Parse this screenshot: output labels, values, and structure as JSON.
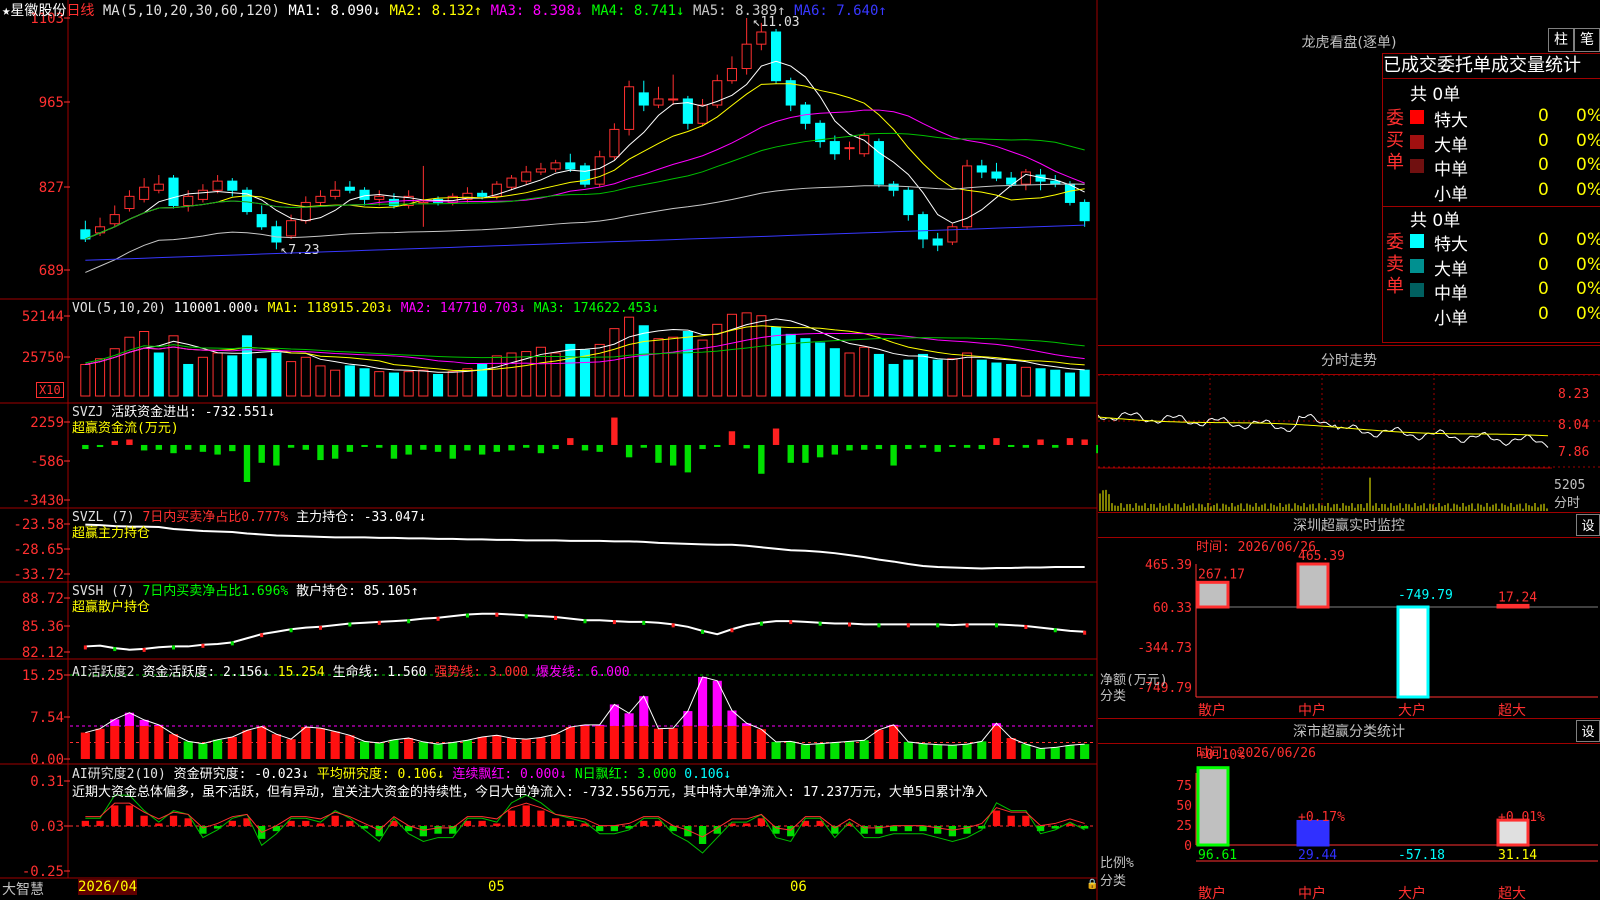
{
  "app": {
    "brand": "大智慧",
    "stock_name": "★星徽股份",
    "period": "日线"
  },
  "axis_dates": {
    "start": "2026/04",
    "may": "05",
    "jun": "06"
  },
  "main_chart": {
    "ma_header": "MA(5,10,20,30,60,120)",
    "ma_values": [
      {
        "label": "MA1: 8.090↓",
        "color": "#ffffff"
      },
      {
        "label": "MA2: 8.132↑",
        "color": "#ffff00"
      },
      {
        "label": "MA3: 8.398↓",
        "color": "#ff00ff"
      },
      {
        "label": "MA4: 8.741↓",
        "color": "#00ff00"
      },
      {
        "label": "MA5: 8.389↑",
        "color": "#c8c8c8"
      },
      {
        "label": "MA6: 7.640↑",
        "color": "#3838ff"
      }
    ],
    "y_ticks": [
      "1103",
      "965",
      "827",
      "689"
    ],
    "high_label": "11.03",
    "low_label": "7.23"
  },
  "vol_panel": {
    "header": "VOL(5,10,20)",
    "value": "110001.000↓",
    "ma1": "MA1: 118915.203↓",
    "ma2": "MA2: 147710.703↓",
    "ma3": "MA3: 174622.453↓",
    "y_ticks": [
      "52144",
      "25750"
    ],
    "unit": "X10"
  },
  "svzj_panel": {
    "header": "SVZJ",
    "line1": "活跃资金进出: -732.551↓",
    "line2": "超赢资金流(万元)",
    "y_ticks": [
      "2259",
      "-586",
      "-3430"
    ]
  },
  "svzl_panel": {
    "header": "SVZL (7)",
    "ratio": "7日内买卖净占比0.777%",
    "value": "主力持仓: -33.047↓",
    "line2": "超赢主力持仓",
    "y_ticks": [
      "-23.58",
      "-28.65",
      "-33.72"
    ]
  },
  "svsh_panel": {
    "header": "SVSH (7)",
    "ratio": "7日内买卖净占比1.696%",
    "value": "散户持仓: 85.105↑",
    "line2": "超赢散户持仓",
    "y_ticks": [
      "88.72",
      "85.36",
      "82.12"
    ]
  },
  "ai2_panel": {
    "header": "AI活跃度2",
    "v1": "资金活跃度: 2.156↓",
    "v2": "15.254",
    "v3": "生命线: 1.560",
    "v4": "强势线: 3.000",
    "v5": "爆发线: 6.000",
    "y_ticks": [
      "15.25",
      "7.54",
      "0.00"
    ]
  },
  "ai_research_panel": {
    "header": "AI研究度2(10)",
    "v1": "资金研究度: -0.023↓",
    "v2": "平均研究度: 0.106↓",
    "v3": "连续飘红: 0.000↓",
    "v4": "N日飘红: 3.000",
    "v5": "0.106↓",
    "commentary": "近期大资金总体偏多，虽不活跃，但有异动，宜关注大资金的持续性，今日大单净流入: -732.556万元，其中特大单净流入: 17.237万元，大单5日累计净入",
    "y_ticks": [
      "0.31",
      "0.03",
      "-0.25"
    ]
  },
  "right_panel": {
    "lhb": {
      "title": "龙虎看盘(逐单)",
      "btn1": "柱",
      "btn2": "笔",
      "tabs": "已成交委托单成交量统计",
      "buy_label": "委买单",
      "sell_label": "委卖单",
      "buy_total": "共 0单",
      "sell_total": "共 0单",
      "buy_rows": [
        {
          "name": "特大",
          "count": "0",
          "pct": "0%",
          "color": "#ff0000"
        },
        {
          "name": "大单",
          "count": "0",
          "pct": "0%",
          "color": "#a01010"
        },
        {
          "name": "中单",
          "count": "0",
          "pct": "0%",
          "color": "#701010"
        },
        {
          "name": "小单",
          "count": "0",
          "pct": "0%",
          "color": "#000000"
        }
      ],
      "sell_rows": [
        {
          "name": "特大",
          "count": "0",
          "pct": "0%",
          "color": "#00ffff"
        },
        {
          "name": "大单",
          "count": "0",
          "pct": "0%",
          "color": "#009090"
        },
        {
          "name": "中单",
          "count": "0",
          "pct": "0%",
          "color": "#006060"
        },
        {
          "name": "小单",
          "count": "0",
          "pct": "0%",
          "color": "#000000"
        }
      ]
    },
    "intraday": {
      "title": "分时走势",
      "y_ticks": [
        "8.23",
        "8.04",
        "7.86"
      ],
      "vol_tick": "5205",
      "vol_unit": "分时"
    },
    "sz_monitor": {
      "title": "深圳超赢实时监控",
      "btn": "设",
      "time": "时间: 2026/06/26",
      "y_ticks": [
        "465.39",
        "60.33",
        "-344.73",
        "-749.79"
      ],
      "ylabel": "净额(万元)",
      "xlabel": "分类",
      "categories": [
        "散户",
        "中户",
        "大户",
        "超大"
      ],
      "values": [
        267.17,
        465.39,
        -749.79,
        17.24
      ],
      "value_labels": [
        "267.17",
        "465.39",
        "-749.79",
        "17.24"
      ]
    },
    "sz_classify": {
      "title": "深市超赢分类统计",
      "btn": "设",
      "time": "时间: 2026/06/26",
      "y_ticks": [
        "75",
        "50",
        "25",
        "0"
      ],
      "ylabel": "比例%",
      "xlabel": "分类",
      "categories": [
        "散户",
        "中户",
        "大户",
        "超大"
      ],
      "top_labels": [
        "+0.10%",
        "+0.17%",
        "",
        "+0.01%"
      ],
      "bottom_labels": [
        "96.61",
        "29.44",
        "-57.18",
        "31.14"
      ],
      "values": [
        96.61,
        29.44,
        -57.18,
        31.14
      ]
    }
  },
  "chart_data": [
    {
      "type": "candlestick",
      "title": "★星徽股份 日线",
      "ylim": [
        6.89,
        11.03
      ],
      "ohlc": [
        [
          7.55,
          7.4,
          7.7,
          7.35
        ],
        [
          7.5,
          7.6,
          7.75,
          7.45
        ],
        [
          7.65,
          7.8,
          7.95,
          7.6
        ],
        [
          7.9,
          8.1,
          8.2,
          7.85
        ],
        [
          8.05,
          8.25,
          8.4,
          8.0
        ],
        [
          8.2,
          8.3,
          8.45,
          8.15
        ],
        [
          8.4,
          7.95,
          8.45,
          7.9
        ],
        [
          7.95,
          8.1,
          8.2,
          7.85
        ],
        [
          8.05,
          8.2,
          8.3,
          8.0
        ],
        [
          8.2,
          8.35,
          8.45,
          8.15
        ],
        [
          8.35,
          8.2,
          8.4,
          8.1
        ],
        [
          8.2,
          7.85,
          8.25,
          7.8
        ],
        [
          7.8,
          7.6,
          7.95,
          7.55
        ],
        [
          7.6,
          7.35,
          7.7,
          7.23
        ],
        [
          7.45,
          7.7,
          7.8,
          7.4
        ],
        [
          7.7,
          8.0,
          8.1,
          7.65
        ],
        [
          8.0,
          8.1,
          8.2,
          7.95
        ],
        [
          8.1,
          8.2,
          8.35,
          8.05
        ],
        [
          8.25,
          8.2,
          8.35,
          8.15
        ],
        [
          8.2,
          8.05,
          8.25,
          7.95
        ],
        [
          8.05,
          8.1,
          8.2,
          7.95
        ],
        [
          8.05,
          7.95,
          8.15,
          7.9
        ],
        [
          7.95,
          8.1,
          8.2,
          7.9
        ],
        [
          7.98,
          8.0,
          8.6,
          7.6
        ],
        [
          8.05,
          8.0,
          8.1,
          7.95
        ],
        [
          8.0,
          8.1,
          8.15,
          7.95
        ],
        [
          8.05,
          8.15,
          8.25,
          8.0
        ],
        [
          8.15,
          8.1,
          8.2,
          8.05
        ],
        [
          8.1,
          8.3,
          8.35,
          8.05
        ],
        [
          8.25,
          8.4,
          8.45,
          8.2
        ],
        [
          8.35,
          8.5,
          8.6,
          8.3
        ],
        [
          8.5,
          8.55,
          8.65,
          8.45
        ],
        [
          8.55,
          8.65,
          8.7,
          8.5
        ],
        [
          8.65,
          8.55,
          8.8,
          8.5
        ],
        [
          8.6,
          8.3,
          8.65,
          8.25
        ],
        [
          8.3,
          8.75,
          8.85,
          8.25
        ],
        [
          8.75,
          9.2,
          9.3,
          8.7
        ],
        [
          9.2,
          9.9,
          10.0,
          9.1
        ],
        [
          9.8,
          9.6,
          10.0,
          9.5
        ],
        [
          9.6,
          9.7,
          9.9,
          9.55
        ],
        [
          9.7,
          9.7,
          10.1,
          9.6
        ],
        [
          9.7,
          9.3,
          9.75,
          9.2
        ],
        [
          9.3,
          9.6,
          9.7,
          9.25
        ],
        [
          9.6,
          10.0,
          10.1,
          9.55
        ],
        [
          10.0,
          10.2,
          10.4,
          9.95
        ],
        [
          10.2,
          10.6,
          11.03,
          10.1
        ],
        [
          10.6,
          10.8,
          10.95,
          10.5
        ],
        [
          10.8,
          10.0,
          10.85,
          9.95
        ],
        [
          10.0,
          9.6,
          10.05,
          9.5
        ],
        [
          9.6,
          9.3,
          9.65,
          9.2
        ],
        [
          9.3,
          9.0,
          9.35,
          8.9
        ],
        [
          9.0,
          8.8,
          9.1,
          8.7
        ],
        [
          8.9,
          8.9,
          9.0,
          8.7
        ],
        [
          8.8,
          9.1,
          9.15,
          8.75
        ],
        [
          9.0,
          8.3,
          9.05,
          8.25
        ],
        [
          8.3,
          8.2,
          8.35,
          8.1
        ],
        [
          8.2,
          7.8,
          8.25,
          7.7
        ],
        [
          7.8,
          7.4,
          7.85,
          7.25
        ],
        [
          7.4,
          7.3,
          7.5,
          7.2
        ],
        [
          7.35,
          7.6,
          7.65,
          7.3
        ],
        [
          7.6,
          8.6,
          8.7,
          7.55
        ],
        [
          8.6,
          8.5,
          8.7,
          8.4
        ],
        [
          8.5,
          8.4,
          8.65,
          8.35
        ],
        [
          8.4,
          8.3,
          8.5,
          8.25
        ],
        [
          8.3,
          8.5,
          8.55,
          8.2
        ],
        [
          8.45,
          8.35,
          8.55,
          8.2
        ],
        [
          8.35,
          8.3,
          8.45,
          8.25
        ],
        [
          8.3,
          8.0,
          8.35,
          7.95
        ],
        [
          8.0,
          7.7,
          8.05,
          7.6
        ]
      ]
    },
    {
      "type": "bar",
      "title": "VOL(5,10,20)",
      "ylim": [
        0,
        60000
      ],
      "values": [
        22000,
        26000,
        33000,
        41000,
        45000,
        30000,
        42000,
        22000,
        27000,
        30000,
        28000,
        42000,
        26000,
        30000,
        24000,
        27000,
        21000,
        18000,
        21000,
        19000,
        17000,
        16000,
        17000,
        18000,
        15000,
        17000,
        19000,
        22000,
        28000,
        30000,
        31000,
        34000,
        30000,
        36000,
        32000,
        36000,
        47000,
        55000,
        49000,
        40000,
        41000,
        45000,
        39000,
        50000,
        57000,
        58000,
        56000,
        48000,
        43000,
        40000,
        37000,
        33000,
        30000,
        34000,
        29000,
        22000,
        25000,
        29000,
        25000,
        26000,
        30000,
        25000,
        23000,
        22000,
        20000,
        19000,
        18000,
        16000,
        18000
      ],
      "colors_up": [
        1,
        1,
        1,
        1,
        1,
        0,
        1,
        0,
        1,
        1,
        0,
        0,
        0,
        0,
        1,
        1,
        1,
        1,
        0,
        0,
        1,
        0,
        1,
        1,
        0,
        1,
        1,
        0,
        1,
        1,
        1,
        1,
        1,
        0,
        0,
        1,
        1,
        1,
        0,
        1,
        1,
        0,
        1,
        1,
        1,
        1,
        1,
        0,
        0,
        0,
        0,
        0,
        1,
        1,
        0,
        0,
        0,
        0,
        0,
        1,
        1,
        0,
        0,
        0,
        1,
        0,
        0,
        0,
        0
      ]
    },
    {
      "type": "bar",
      "title": "SVZJ 超赢资金流(万元)",
      "ylim": [
        -3430,
        2259
      ],
      "values": [
        -300,
        -150,
        300,
        400,
        -400,
        -350,
        -600,
        -350,
        -500,
        -700,
        -450,
        -2700,
        -1300,
        -1500,
        -200,
        -350,
        -1100,
        -1000,
        -500,
        -100,
        -200,
        -1000,
        -700,
        -350,
        -500,
        -1000,
        -400,
        -700,
        -500,
        -400,
        -200,
        -600,
        -300,
        500,
        -400,
        -500,
        2000,
        -900,
        -200,
        -1300,
        -1500,
        -2000,
        -300,
        -100,
        1000,
        -250,
        -2100,
        1200,
        -1300,
        -1300,
        -900,
        -700,
        -400,
        -350,
        -300,
        -1500,
        -300,
        -200,
        -500,
        -100,
        -200,
        -300,
        500,
        -100,
        -200,
        400,
        -200,
        500,
        400,
        -600
      ],
      "ma_line": true
    },
    {
      "type": "line",
      "title": "SVZL 超赢主力持仓",
      "ylim": [
        -33.72,
        -23.58
      ],
      "values": [
        -23.7,
        -23.8,
        -24.0,
        -24.1,
        -24.1,
        -24.2,
        -24.6,
        -24.8,
        -25.0,
        -25.1,
        -25.2,
        -25.5,
        -25.7,
        -25.9,
        -26.0,
        -26.1,
        -26.2,
        -26.3,
        -26.3,
        -26.3,
        -26.4,
        -26.4,
        -26.5,
        -26.5,
        -26.6,
        -26.6,
        -26.7,
        -26.7,
        -26.8,
        -26.8,
        -26.9,
        -26.9,
        -26.9,
        -27.0,
        -27.0,
        -27.0,
        -27.1,
        -27.1,
        -27.2,
        -27.4,
        -27.5,
        -27.6,
        -27.7,
        -27.8,
        -27.8,
        -28.0,
        -28.3,
        -28.6,
        -28.9,
        -29.0,
        -29.2,
        -29.5,
        -29.9,
        -30.3,
        -30.8,
        -31.2,
        -31.7,
        -32.1,
        -32.3,
        -32.4,
        -32.5,
        -32.6,
        -32.5,
        -32.5,
        -32.4,
        -32.4,
        -32.3,
        -32.3,
        -32.3
      ]
    },
    {
      "type": "line",
      "title": "SVSH 超赢散户持仓",
      "ylim": [
        82.12,
        88.72
      ],
      "values": [
        82.8,
        82.9,
        82.6,
        82.4,
        82.5,
        82.7,
        82.8,
        82.8,
        83.0,
        83.1,
        83.3,
        83.8,
        84.3,
        84.6,
        84.9,
        85.1,
        85.2,
        85.4,
        85.6,
        85.7,
        85.8,
        85.9,
        86.0,
        86.2,
        86.3,
        86.5,
        86.7,
        86.8,
        86.8,
        86.7,
        86.6,
        86.5,
        86.4,
        86.2,
        86.0,
        86.0,
        85.9,
        85.8,
        85.8,
        85.7,
        85.5,
        85.2,
        84.7,
        84.3,
        84.9,
        85.4,
        85.7,
        85.9,
        85.9,
        85.8,
        85.7,
        85.6,
        85.6,
        85.5,
        85.5,
        85.5,
        85.5,
        85.5,
        85.5,
        85.4,
        85.5,
        85.5,
        85.5,
        85.4,
        85.3,
        85.1,
        84.9,
        84.7,
        84.6
      ]
    },
    {
      "type": "bar",
      "title": "AI活跃度2",
      "ylim": [
        0,
        15.25
      ],
      "values": [
        4.8,
        5.5,
        7.2,
        8.4,
        7.1,
        6.2,
        4.5,
        3.2,
        2.8,
        3.5,
        4.0,
        5.2,
        5.9,
        4.5,
        3.6,
        5.8,
        5.6,
        5.0,
        4.3,
        3.2,
        2.9,
        3.5,
        3.8,
        3.1,
        2.7,
        3.0,
        3.4,
        4.0,
        4.3,
        3.8,
        3.6,
        3.9,
        4.5,
        5.8,
        6.2,
        6.2,
        9.9,
        8.3,
        11.4,
        5.5,
        5.6,
        8.7,
        14.9,
        14.2,
        8.8,
        6.5,
        5.4,
        3.1,
        3.2,
        2.6,
        2.8,
        3.0,
        3.2,
        3.4,
        5.3,
        6.2,
        3.1,
        2.8,
        2.6,
        2.5,
        2.7,
        3.2,
        6.5,
        3.8,
        2.7,
        1.9,
        2.1,
        2.5,
        2.7
      ]
    },
    {
      "type": "bar",
      "title": "AI研究度2(10)",
      "ylim": [
        -0.25,
        0.31
      ],
      "values": [
        0.02,
        0.02,
        0.08,
        0.08,
        0.04,
        0.01,
        0.04,
        0.03,
        -0.03,
        -0.01,
        0.02,
        0.03,
        -0.05,
        -0.02,
        0.02,
        0.02,
        0.01,
        0.04,
        0.02,
        -0.01,
        -0.04,
        0.02,
        -0.02,
        -0.04,
        -0.03,
        -0.03,
        0.02,
        0.02,
        0.01,
        0.06,
        0.08,
        0.06,
        0.03,
        0.02,
        0.01,
        -0.02,
        -0.02,
        -0.01,
        0.02,
        0.02,
        -0.02,
        -0.04,
        -0.07,
        -0.03,
        0.01,
        0.01,
        0.03,
        -0.03,
        -0.04,
        0.02,
        0.02,
        -0.03,
        0.01,
        -0.03,
        -0.03,
        -0.02,
        -0.02,
        -0.02,
        -0.03,
        -0.04,
        -0.03,
        -0.01,
        0.06,
        0.04,
        0.04,
        -0.02,
        -0.01,
        0.01,
        -0.01
      ]
    }
  ]
}
